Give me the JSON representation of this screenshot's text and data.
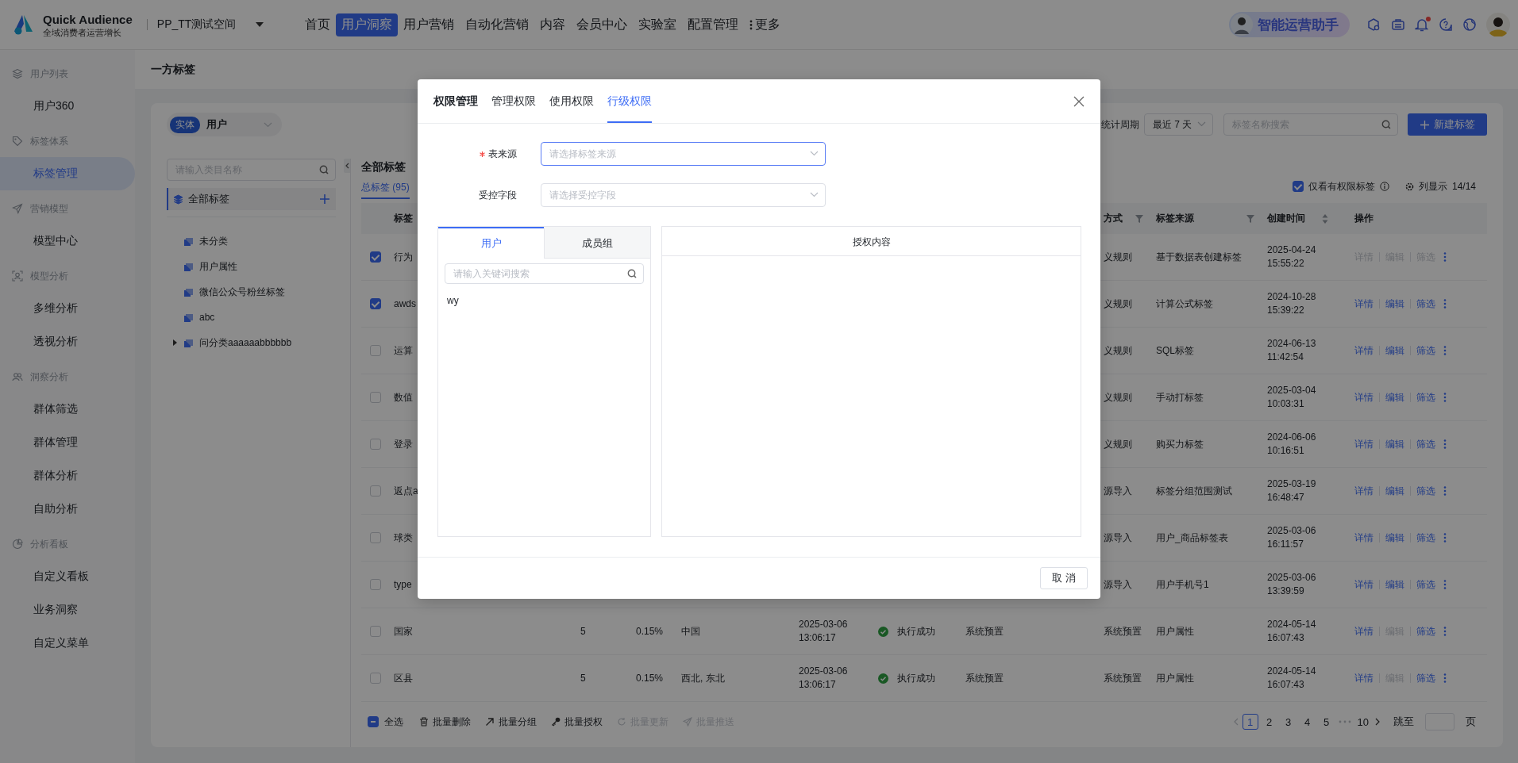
{
  "header": {
    "brand": {
      "name": "Quick Audience",
      "tagline": "全域消费者运营增长"
    },
    "workspace": "PP_TT测试空间",
    "nav": [
      {
        "label": "首页",
        "selected": false
      },
      {
        "label": "用户洞察",
        "selected": true
      },
      {
        "label": "用户营销",
        "selected": false
      },
      {
        "label": "自动化营销",
        "selected": false
      },
      {
        "label": "内容",
        "selected": false
      },
      {
        "label": "会员中心",
        "selected": false
      },
      {
        "label": "实验室",
        "selected": false
      },
      {
        "label": "配置管理",
        "selected": false
      }
    ],
    "more": "更多",
    "assistant": "智能运营助手",
    "notifications": {
      "unread": true
    }
  },
  "sidebar": {
    "groups": [
      {
        "title": "用户列表",
        "items": [
          {
            "label": "用户360",
            "selected": false
          }
        ]
      },
      {
        "title": "标签体系",
        "items": [
          {
            "label": "标签管理",
            "selected": true
          }
        ]
      },
      {
        "title": "营销模型",
        "items": [
          {
            "label": "模型中心",
            "selected": false
          }
        ]
      },
      {
        "title": "模型分析",
        "items": [
          {
            "label": "多维分析",
            "selected": false
          },
          {
            "label": "透视分析",
            "selected": false
          }
        ]
      },
      {
        "title": "洞察分析",
        "items": [
          {
            "label": "群体筛选",
            "selected": false
          },
          {
            "label": "群体管理",
            "selected": false
          },
          {
            "label": "群体分析",
            "selected": false
          },
          {
            "label": "自助分析",
            "selected": false
          }
        ]
      },
      {
        "title": "分析看板",
        "items": [
          {
            "label": "自定义看板",
            "selected": false
          },
          {
            "label": "业务洞察",
            "selected": false
          },
          {
            "label": "自定义菜单",
            "selected": false
          }
        ]
      }
    ]
  },
  "breadcrumb": "一方标签",
  "toolbar": {
    "entity": {
      "badge": "实体",
      "value": "用户"
    },
    "period_label": "统计周期",
    "period": "最近 7 天",
    "search_placeholder": "标签名称搜索",
    "create_button": "新建标签"
  },
  "category_tree": {
    "search_placeholder": "请输入类目名称",
    "root": {
      "label": "全部标签",
      "selected": true
    },
    "items": [
      {
        "label": "未分类",
        "kind": "leaf"
      },
      {
        "label": "用户属性",
        "kind": "leaf"
      },
      {
        "label": "微信公众号粉丝标签",
        "kind": "leaf"
      },
      {
        "label": "abc",
        "kind": "leaf"
      },
      {
        "label": "问分类aaaaaabbbbbb",
        "kind": "folder",
        "expanded": false
      }
    ]
  },
  "content": {
    "title": "全部标签",
    "tabs": [
      {
        "label": "总标签 (95)",
        "selected": true
      }
    ],
    "only_permitted": {
      "label": "仅看有权限标签",
      "checked": true
    },
    "column_display": {
      "label": "列显示",
      "count": "14/14"
    }
  },
  "table": {
    "columns": {
      "name": {
        "label": "标签"
      },
      "method": {
        "label": "方式",
        "filter": true
      },
      "source": {
        "label": "标签来源",
        "filter": true
      },
      "created": {
        "label": "创建时间",
        "sortable": true
      },
      "ops": {
        "label": "操作"
      }
    },
    "rows": [
      {
        "checked": true,
        "name": "行为",
        "method": "义规则",
        "source": "基于数据表创建标签",
        "created": "2025-04-24 15:55:22",
        "actions": [
          {
            "label": "详情",
            "disabled": true
          },
          {
            "label": "编辑",
            "disabled": true
          },
          {
            "label": "筛选",
            "disabled": true
          }
        ]
      },
      {
        "checked": true,
        "name": "awds",
        "method": "义规则",
        "source": "计算公式标签",
        "created": "2024-10-28 15:39:22",
        "actions": [
          {
            "label": "详情",
            "disabled": false
          },
          {
            "label": "编辑",
            "disabled": false
          },
          {
            "label": "筛选",
            "disabled": false
          }
        ]
      },
      {
        "checked": false,
        "name": "运算",
        "method": "义规则",
        "source": "SQL标签",
        "created": "2024-06-13 11:42:54",
        "actions": [
          {
            "label": "详情",
            "disabled": false
          },
          {
            "label": "编辑",
            "disabled": false
          },
          {
            "label": "筛选",
            "disabled": false
          }
        ]
      },
      {
        "checked": false,
        "name": "数值",
        "method": "义规则",
        "source": "手动打标签",
        "created": "2025-03-04 10:03:31",
        "actions": [
          {
            "label": "详情",
            "disabled": false
          },
          {
            "label": "编辑",
            "disabled": false
          },
          {
            "label": "筛选",
            "disabled": false
          }
        ]
      },
      {
        "checked": false,
        "name": "登录",
        "method": "义规则",
        "source": "购买力标签",
        "created": "2024-06-06 10:16:51",
        "actions": [
          {
            "label": "详情",
            "disabled": false
          },
          {
            "label": "编辑",
            "disabled": false
          },
          {
            "label": "筛选",
            "disabled": false
          }
        ]
      },
      {
        "checked": false,
        "name": "返点a",
        "method": "源导入",
        "source": "标签分组范围测试",
        "created": "2025-03-19 16:48:47",
        "actions": [
          {
            "label": "详情",
            "disabled": false
          },
          {
            "label": "编辑",
            "disabled": false
          },
          {
            "label": "筛选",
            "disabled": false
          }
        ]
      },
      {
        "checked": false,
        "name": "球类",
        "method": "源导入",
        "source": "用户_商品标签表",
        "created": "2025-03-06 16:11:57",
        "actions": [
          {
            "label": "详情",
            "disabled": false
          },
          {
            "label": "编辑",
            "disabled": false
          },
          {
            "label": "筛选",
            "disabled": false
          }
        ]
      },
      {
        "checked": false,
        "name": "type",
        "method": "源导入",
        "source": "用户手机号1",
        "created": "2025-03-06 13:39:59",
        "actions": [
          {
            "label": "详情",
            "disabled": false
          },
          {
            "label": "编辑",
            "disabled": false
          },
          {
            "label": "筛选",
            "disabled": false
          }
        ]
      },
      {
        "checked": false,
        "name": "国家",
        "count": "5",
        "coverage": "0.15%",
        "value": "中国",
        "updated": "2025-03-06 13:06:17",
        "status": {
          "text": "执行成功",
          "kind": "success"
        },
        "type": "系统预置",
        "method": "系统预置",
        "source": "用户属性",
        "created": "2024-05-14 16:07:43",
        "actions": [
          {
            "label": "详情",
            "disabled": false
          },
          {
            "label": "编辑",
            "disabled": true
          },
          {
            "label": "筛选",
            "disabled": false
          }
        ]
      },
      {
        "checked": false,
        "name": "区县",
        "count": "5",
        "coverage": "0.15%",
        "value": "西北, 东北",
        "updated": "2025-03-06 13:06:17",
        "status": {
          "text": "执行成功",
          "kind": "success"
        },
        "type": "系统预置",
        "method": "系统预置",
        "source": "用户属性",
        "created": "2024-05-14 16:07:43",
        "actions": [
          {
            "label": "详情",
            "disabled": false
          },
          {
            "label": "编辑",
            "disabled": true
          },
          {
            "label": "筛选",
            "disabled": false
          }
        ]
      }
    ]
  },
  "bulk_bar": {
    "select_all": {
      "label": "全选",
      "indeterminate": true
    },
    "actions": [
      {
        "label": "批量删除",
        "disabled": false
      },
      {
        "label": "批量分组",
        "disabled": false
      },
      {
        "label": "批量授权",
        "disabled": false
      },
      {
        "label": "批量更新",
        "disabled": true
      },
      {
        "label": "批量推送",
        "disabled": true
      }
    ]
  },
  "pagination": {
    "prev_disabled": true,
    "next_disabled": false,
    "pages": [
      {
        "kind": "page",
        "label": "1",
        "selected": true
      },
      {
        "kind": "page",
        "label": "2",
        "selected": false
      },
      {
        "kind": "page",
        "label": "3",
        "selected": false
      },
      {
        "kind": "page",
        "label": "4",
        "selected": false
      },
      {
        "kind": "page",
        "label": "5",
        "selected": false
      },
      {
        "kind": "ellipsis"
      },
      {
        "kind": "page",
        "label": "10",
        "selected": false
      }
    ],
    "jump_label": "跳至",
    "page_suffix": "页"
  },
  "dialog": {
    "title": "权限管理",
    "tabs": [
      {
        "label": "管理权限",
        "selected": false
      },
      {
        "label": "使用权限",
        "selected": false
      },
      {
        "label": "行级权限",
        "selected": true
      }
    ],
    "fields": [
      {
        "label": "表来源",
        "required": true,
        "placeholder": "请选择标签来源",
        "focused": true
      },
      {
        "label": "受控字段",
        "required": false,
        "placeholder": "请选择受控字段",
        "focused": false
      }
    ],
    "member_panel": {
      "tabs": [
        {
          "label": "用户",
          "selected": true
        },
        {
          "label": "成员组",
          "selected": false
        }
      ],
      "search_placeholder": "请输入关键词搜索",
      "items": [
        {
          "label": "wy"
        }
      ]
    },
    "content_panel": {
      "title": "授权内容"
    },
    "cancel_button": "取 消"
  }
}
